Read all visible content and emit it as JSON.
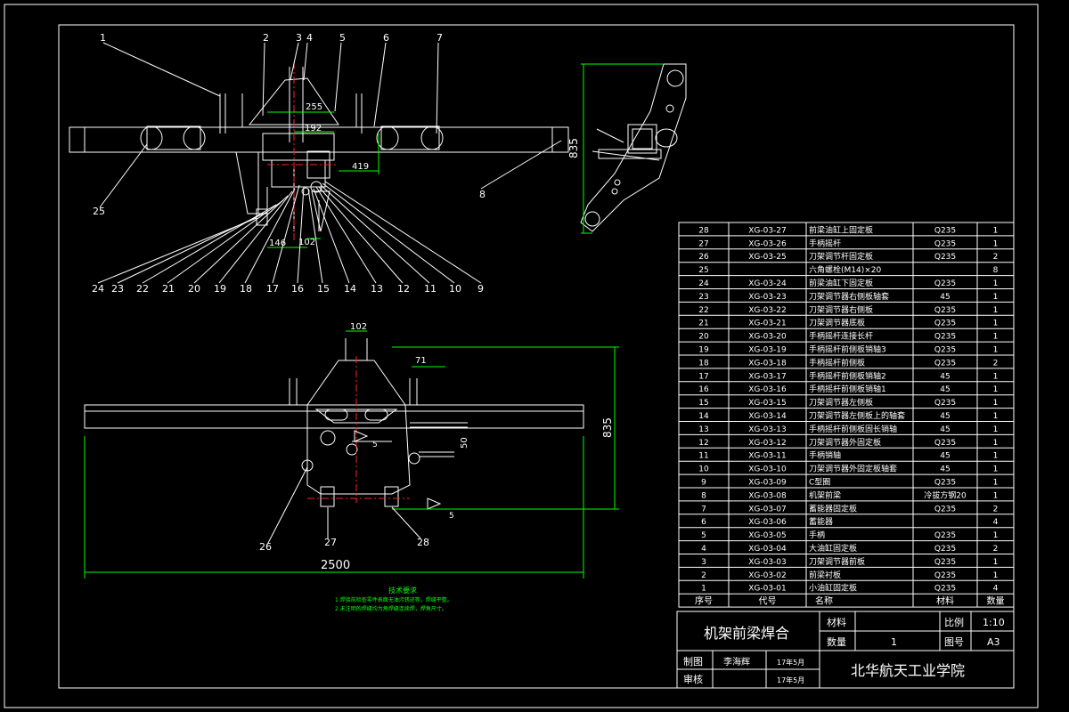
{
  "callouts_top": [
    "24",
    "23",
    "22",
    "21",
    "20",
    "19",
    "18",
    "17",
    "16",
    "15",
    "14",
    "13",
    "12",
    "11",
    "10",
    "9"
  ],
  "callouts_topline": [
    "1",
    "2",
    "3",
    "4",
    "5",
    "6",
    "7"
  ],
  "callout_8": "8",
  "callout_25": "25",
  "dims_front": {
    "d255": "255",
    "d192": "192",
    "d419": "419",
    "d146": "146",
    "d102": "102"
  },
  "side_dim": "835",
  "bottom_dims": {
    "d102": "102",
    "d71": "71",
    "d835": "835",
    "d2500": "2500",
    "d50": "50"
  },
  "bottom_callouts": {
    "c26": "26",
    "c27": "27",
    "c28": "28"
  },
  "weld_marks": {
    "w1": "5",
    "w2": "5"
  },
  "tech_req": {
    "title": "技术要求",
    "line1": "1.焊接前检查零件表面无油污锈迹等，焊缝平整。",
    "line2": "2.未注明的焊缝均为角焊缝连续焊，焊角尺寸。"
  },
  "bom": [
    {
      "no": "28",
      "code": "XG-03-27",
      "name": "前梁油缸上固定板",
      "mat": "Q235",
      "qty": "1"
    },
    {
      "no": "27",
      "code": "XG-03-26",
      "name": "手柄摇杆",
      "mat": "Q235",
      "qty": "1"
    },
    {
      "no": "26",
      "code": "XG-03-25",
      "name": "刀架调节杆固定板",
      "mat": "Q235",
      "qty": "2"
    },
    {
      "no": "25",
      "code": "",
      "name": "六角螺栓(M14)×20",
      "mat": "",
      "qty": "8"
    },
    {
      "no": "24",
      "code": "XG-03-24",
      "name": "前梁油缸下固定板",
      "mat": "Q235",
      "qty": "1"
    },
    {
      "no": "23",
      "code": "XG-03-23",
      "name": "刀架调节器右侧板轴套",
      "mat": "45",
      "qty": "1"
    },
    {
      "no": "22",
      "code": "XG-03-22",
      "name": "刀架调节器右侧板",
      "mat": "Q235",
      "qty": "1"
    },
    {
      "no": "21",
      "code": "XG-03-21",
      "name": "刀架调节器底板",
      "mat": "Q235",
      "qty": "1"
    },
    {
      "no": "20",
      "code": "XG-03-20",
      "name": "手柄摇杆连接长杆",
      "mat": "Q235",
      "qty": "1"
    },
    {
      "no": "19",
      "code": "XG-03-19",
      "name": "手柄摇杆前侧板销轴3",
      "mat": "Q235",
      "qty": "1"
    },
    {
      "no": "18",
      "code": "XG-03-18",
      "name": "手柄摇杆前侧板",
      "mat": "Q235",
      "qty": "2"
    },
    {
      "no": "17",
      "code": "XG-03-17",
      "name": "手柄摇杆前侧板销轴2",
      "mat": "45",
      "qty": "1"
    },
    {
      "no": "16",
      "code": "XG-03-16",
      "name": "手柄摇杆前侧板销轴1",
      "mat": "45",
      "qty": "1"
    },
    {
      "no": "15",
      "code": "XG-03-15",
      "name": "刀架调节器左侧板",
      "mat": "Q235",
      "qty": "1"
    },
    {
      "no": "14",
      "code": "XG-03-14",
      "name": "刀架调节器左侧板上的轴套",
      "mat": "45",
      "qty": "1"
    },
    {
      "no": "13",
      "code": "XG-03-13",
      "name": "手柄摇杆前侧板固长销轴",
      "mat": "45",
      "qty": "1"
    },
    {
      "no": "12",
      "code": "XG-03-12",
      "name": "刀架调节器外固定板",
      "mat": "Q235",
      "qty": "1"
    },
    {
      "no": "11",
      "code": "XG-03-11",
      "name": "手柄销轴",
      "mat": "45",
      "qty": "1"
    },
    {
      "no": "10",
      "code": "XG-03-10",
      "name": "刀架调节器外固定板轴套",
      "mat": "45",
      "qty": "1"
    },
    {
      "no": "9",
      "code": "XG-03-09",
      "name": "C型圈",
      "mat": "Q235",
      "qty": "1"
    },
    {
      "no": "8",
      "code": "XG-03-08",
      "name": "机架前梁",
      "mat": "冷拔方钢20",
      "qty": "1"
    },
    {
      "no": "7",
      "code": "XG-03-07",
      "name": "蓄能器固定板",
      "mat": "Q235",
      "qty": "2"
    },
    {
      "no": "6",
      "code": "XG-03-06",
      "name": "蓄能器",
      "mat": "",
      "qty": "4"
    },
    {
      "no": "5",
      "code": "XG-03-05",
      "name": "手柄",
      "mat": "Q235",
      "qty": "1"
    },
    {
      "no": "4",
      "code": "XG-03-04",
      "name": "大油缸固定板",
      "mat": "Q235",
      "qty": "2"
    },
    {
      "no": "3",
      "code": "XG-03-03",
      "name": "刀架调节器前板",
      "mat": "Q235",
      "qty": "1"
    },
    {
      "no": "2",
      "code": "XG-03-02",
      "name": "前梁衬板",
      "mat": "Q235",
      "qty": "1"
    },
    {
      "no": "1",
      "code": "XG-03-01",
      "name": "小油缸固定板",
      "mat": "Q235",
      "qty": "4"
    }
  ],
  "bom_header": {
    "no": "序号",
    "code": "代号",
    "name": "名称",
    "mat": "材料",
    "qty": "数量"
  },
  "title_block": {
    "drawing_name": "机架前梁焊合",
    "material_label": "材料",
    "scale_label": "比例",
    "scale_value": "1:10",
    "qty_label": "数量",
    "qty_value": "1",
    "sheet_label": "图号",
    "sheet_value": "A3",
    "drawn_label": "制图",
    "drawn_name": "李海辉",
    "drawn_date": "17年5月",
    "check_label": "审核",
    "check_date": "17年5月",
    "school": "北华航天工业学院"
  }
}
